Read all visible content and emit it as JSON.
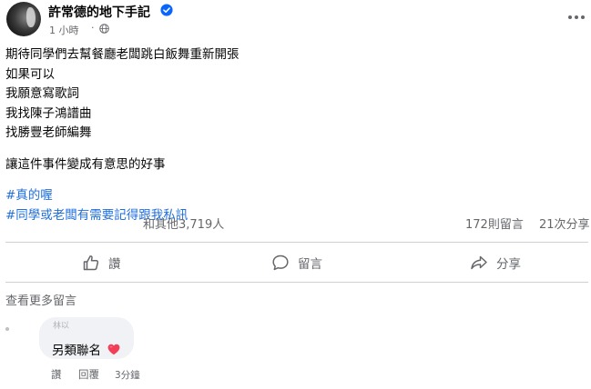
{
  "post": {
    "page_name": "許常德的地下手記",
    "time": "1 小時",
    "separator": "·",
    "body_lines": [
      "期待同學們去幫餐廳老闆跳白飯舞重新開張",
      "如果可以",
      "我願意寫歌詞",
      "我找陳子鴻譜曲",
      "找勝豐老師編舞"
    ],
    "body_line_2": "讓這件事件變成有意思的好事",
    "hashtags": [
      "#真的喔",
      "#同學或老闆有需要記得跟我私訊"
    ]
  },
  "stats": {
    "reactions": "和其他3,719人",
    "comments": "172則留言",
    "shares": "21次分享"
  },
  "actions": {
    "like": "讚",
    "comment": "留言",
    "share": "分享"
  },
  "comments_section": {
    "view_more": "查看更多留言",
    "comment": {
      "author": "林以",
      "text": "另類聯名",
      "like": "讚",
      "reply": "回覆",
      "time": "3分鐘"
    }
  },
  "colors": {
    "link": "#216fdb",
    "secondary_text": "#65676b",
    "verified": "#0866ff",
    "heart": "#f33e58"
  },
  "icons": [
    "avatar",
    "verified-badge-icon",
    "globe-icon",
    "more-options-icon",
    "like-icon",
    "comment-icon",
    "share-icon",
    "heart-emoji-icon"
  ]
}
